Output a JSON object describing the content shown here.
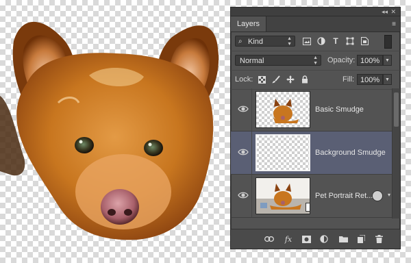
{
  "panel": {
    "tab_label": "Layers",
    "collapse_glyph": "◂◂",
    "close_glyph": "✕",
    "menu_glyph": "≡"
  },
  "filter": {
    "kind_label": "Kind",
    "icons": [
      "image-filter-icon",
      "adjustment-filter-icon",
      "type-filter-icon",
      "shape-filter-icon",
      "smart-object-filter-icon"
    ]
  },
  "blend": {
    "mode": "Normal",
    "opacity_label": "Opacity:",
    "opacity_value": "100%"
  },
  "lock": {
    "label": "Lock:",
    "fill_label": "Fill:",
    "fill_value": "100%"
  },
  "layers": [
    {
      "name": "Basic Smudge",
      "selected": false,
      "visible": true
    },
    {
      "name": "Background Smudge",
      "selected": true,
      "visible": true
    },
    {
      "name": "Pet Portrait Ret...",
      "selected": false,
      "visible": true,
      "smart_object": true,
      "has_effects_badge": true
    }
  ],
  "bottom_icons": [
    "link-layers-icon",
    "fx-icon",
    "add-mask-icon",
    "adjustment-layer-icon",
    "new-group-icon",
    "new-layer-icon",
    "delete-layer-icon"
  ],
  "fx_label": "fx",
  "colors": {
    "panel_bg": "#535353",
    "selected_layer": "#5a5f74",
    "dog_fur": "#c8761f"
  }
}
